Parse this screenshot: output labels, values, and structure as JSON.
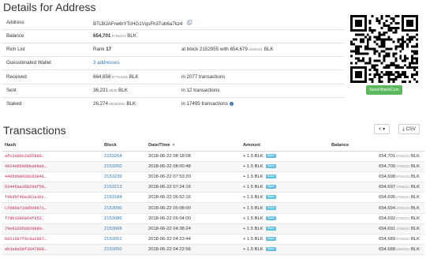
{
  "details": {
    "title": "Details for Address",
    "address_label": "Address",
    "address_value": "BTiJ8JAFrw6rYTcHG1VqsFh3Tub6a7kz4",
    "copy_icon": "copy-icon",
    "balance_label": "Balance",
    "balance_int": "654,701",
    "balance_dec": ".8765231",
    "balance_unit": "BLK",
    "richlist_label": "Rich List",
    "rank_prefix": "Rank",
    "rank_value": "17",
    "richlist_block_text": "at block 2152955 with 654,679",
    "richlist_block_dec": ".3484231",
    "richlist_block_unit": "BLK",
    "wallet_label": "Guesstimated Wallet",
    "wallet_value": "3 addresses",
    "received_label": "Received",
    "received_int": "664,658",
    "received_dec": ".87761655",
    "received_unit": "BLK",
    "received_tx": "in 2077 transactions",
    "sent_label": "Sent",
    "sent_int": "36,231",
    "sent_dec": ".8826",
    "sent_unit": "BLK",
    "sent_tx": "in 12 transactions",
    "staked_label": "Staked",
    "staked_int": "26,274",
    "staked_dec": ".86150692",
    "staked_unit": "BLK",
    "staked_tx": "in 17495 transactions",
    "info_icon": "info-icon",
    "send_button": "Send BlackCoin"
  },
  "transactions": {
    "title": "Transactions",
    "nav_button": "< ▾",
    "csv_button": "⤓ CSV",
    "columns": {
      "hash": "Hash",
      "block": "Block",
      "datetime": "Date/Time",
      "amount": "Amount",
      "balance": "Balance"
    },
    "rows": [
      {
        "hash": "afc2a00c2a55880…",
        "block": "2153264",
        "datetime": "2018-06-22 08:18:08",
        "amount": "+ 1.5 BLK",
        "badge": "Stake",
        "bal_int": "654,701",
        "bal_dec": ".8765231",
        "bal_unit": "BLK"
      },
      {
        "hash": "4924eb500bba09a6…",
        "block": "2153250",
        "datetime": "2018-06-22 08:00:48",
        "amount": "+ 1.5 BLK",
        "badge": "Stake",
        "bal_int": "654,700",
        "bal_dec": ".3765231",
        "bal_unit": "BLK"
      },
      {
        "hash": "446bd989281d3848…",
        "block": "2153239",
        "datetime": "2018-06-22 07:53:20",
        "amount": "+ 1.5 BLK",
        "badge": "Stake",
        "bal_int": "654,698",
        "bal_dec": ".8765231",
        "bal_unit": "BLK"
      },
      {
        "hash": "63445aa36b29af59…",
        "block": "2153213",
        "datetime": "2018-06-22 07:24:16",
        "amount": "+ 1.5 BLK",
        "badge": "Stake",
        "bal_int": "654,697",
        "bal_dec": ".3765231",
        "bal_unit": "BLK"
      },
      {
        "hash": "fd6dbf45a302a16c…",
        "block": "2153184",
        "datetime": "2018-06-22 06:52:16",
        "amount": "+ 1.5 BLK",
        "badge": "Stake",
        "bal_int": "654,695",
        "bal_dec": ".8765231",
        "bal_unit": "BLK"
      },
      {
        "hash": "c7096a710d568871…",
        "block": "2153090",
        "datetime": "2018-06-22 05:08:00",
        "amount": "+ 1.5 BLK",
        "badge": "Stake",
        "bal_int": "654,694",
        "bal_dec": ".3765231",
        "bal_unit": "BLK"
      },
      {
        "hash": "f7db3386064f952…",
        "block": "2153086",
        "datetime": "2018-06-22 05:04:00",
        "amount": "+ 1.5 BLK",
        "badge": "Stake",
        "bal_int": "654,692",
        "bal_dec": ".8765231",
        "bal_unit": "BLK"
      },
      {
        "hash": "79e832056029880…",
        "block": "2153068",
        "datetime": "2018-06-22 04:38:24",
        "amount": "+ 1.5 BLK",
        "badge": "Stake",
        "bal_int": "654,691",
        "bal_dec": ".3765231",
        "bal_unit": "BLK"
      },
      {
        "hash": "6921687f5c9a2967…",
        "block": "2153051",
        "datetime": "2018-06-22 04:23:44",
        "amount": "+ 1.5 BLK",
        "badge": "Stake",
        "bal_int": "654,689",
        "bal_dec": ".8765231",
        "bal_unit": "BLK"
      },
      {
        "hash": "eb3a8a58f3847868…",
        "block": "2153050",
        "datetime": "2018-06-22 04:22:56",
        "amount": "+ 1.5 BLK",
        "badge": "Stake",
        "bal_int": "654,688",
        "bal_dec": ".3465231",
        "bal_unit": "BLK"
      }
    ]
  }
}
